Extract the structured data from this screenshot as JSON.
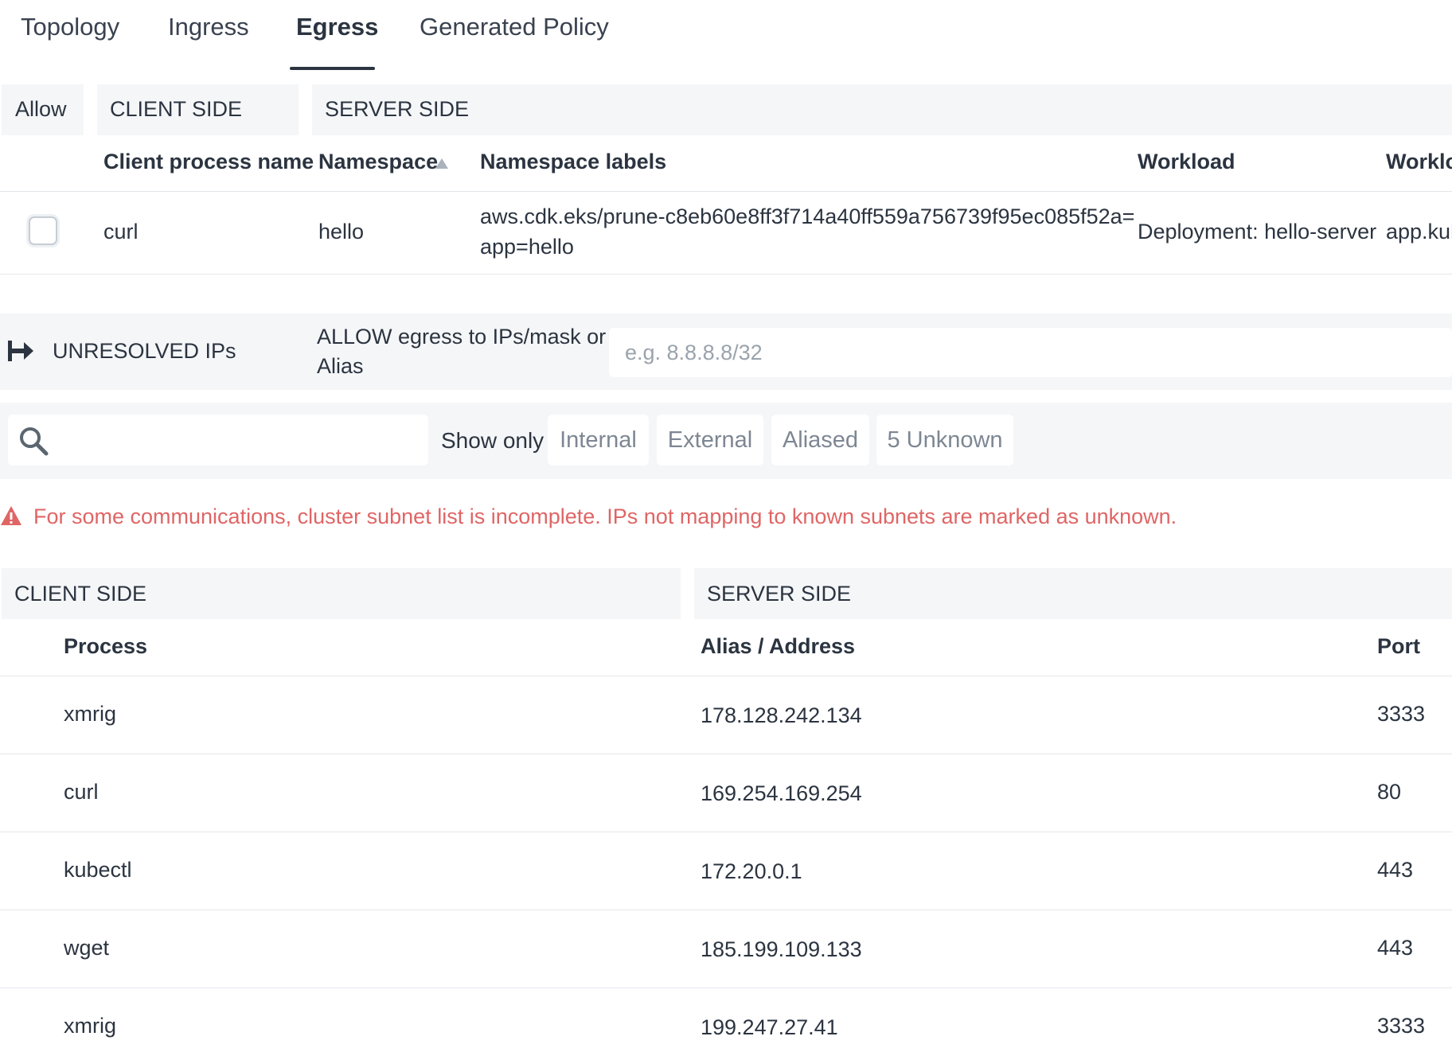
{
  "tabs": [
    {
      "label": "Topology"
    },
    {
      "label": "Ingress"
    },
    {
      "label": "Egress"
    },
    {
      "label": "Generated Policy"
    }
  ],
  "active_tab": "Egress",
  "policy_table": {
    "group_headers": {
      "allow": "Allow",
      "client": "CLIENT SIDE",
      "server": "SERVER SIDE"
    },
    "columns": {
      "client_process": "Client process name",
      "namespace": "Namespace",
      "namespace_labels": "Namespace labels",
      "workload": "Workload",
      "workload_labels": "Worklo"
    },
    "row": {
      "client_process": "curl",
      "namespace": "hello",
      "namespace_labels_line1": "aws.cdk.eks/prune-c8eb60e8ff3f714a40ff559a756739f95ec085f52a=",
      "namespace_labels_line2": "app=hello",
      "workload": "Deployment: hello-server",
      "workload_labels": "app.kub"
    }
  },
  "unresolved": {
    "title": "UNRESOLVED IPs",
    "allow_label_line1": "ALLOW egress to IPs/mask or",
    "allow_label_line2": "Alias",
    "placeholder": "e.g. 8.8.8.8/32"
  },
  "filter": {
    "search_value": "",
    "show_only_label": "Show only",
    "chips": [
      {
        "label": "Internal"
      },
      {
        "label": "External"
      },
      {
        "label": "Aliased"
      },
      {
        "label": "5 Unknown"
      }
    ]
  },
  "warning": "For some communications, cluster subnet list is incomplete. IPs not mapping to known subnets are marked as unknown.",
  "ip_table": {
    "group_headers": {
      "client": "CLIENT SIDE",
      "server": "SERVER SIDE"
    },
    "columns": {
      "process": "Process",
      "address": "Alias / Address",
      "port": "Port"
    },
    "rows": [
      {
        "process": "xmrig",
        "address": "178.128.242.134",
        "port": "3333"
      },
      {
        "process": "curl",
        "address": "169.254.169.254",
        "port": "80"
      },
      {
        "process": "kubectl",
        "address": "172.20.0.1",
        "port": "443"
      },
      {
        "process": "wget",
        "address": "185.199.109.133",
        "port": "443"
      },
      {
        "process": "xmrig",
        "address": "199.247.27.41",
        "port": "3333"
      }
    ]
  },
  "colors": {
    "warning": "#e06565",
    "panel_bg": "#f5f6f8",
    "text": "#2b3440"
  }
}
